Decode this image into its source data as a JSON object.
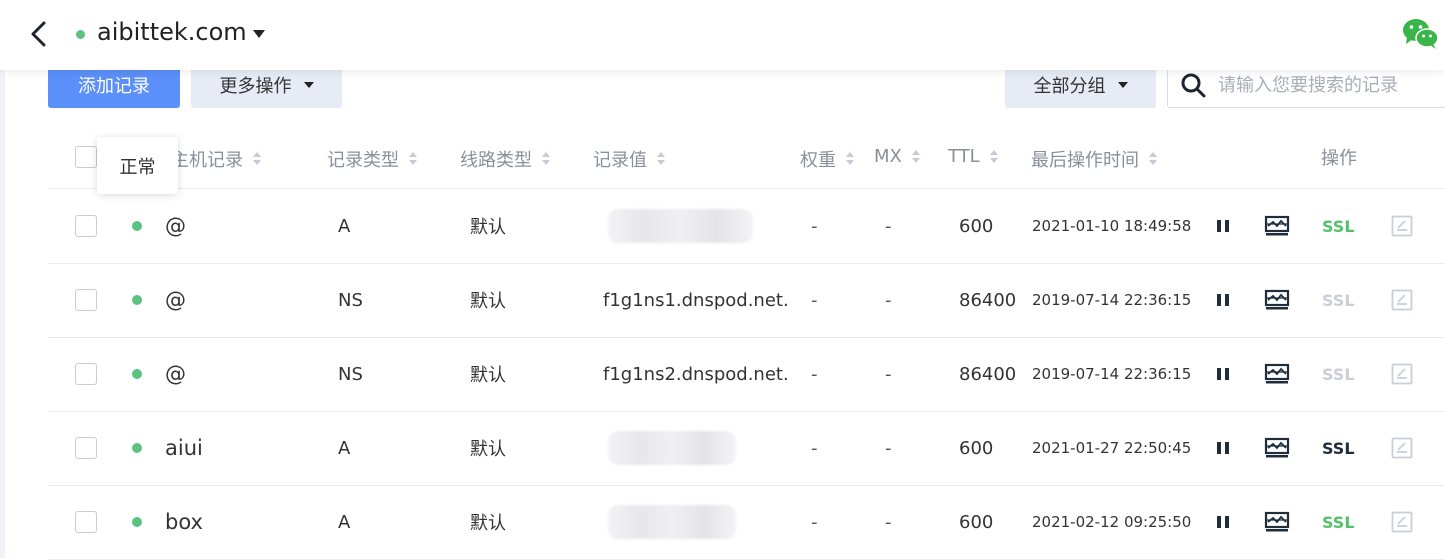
{
  "header": {
    "domain": "aibittek.com",
    "status_color": "#5cc281"
  },
  "toolbar": {
    "add_label": "添加记录",
    "more_label": "更多操作",
    "group_label": "全部分组",
    "search_placeholder": "请输入您要搜索的记录"
  },
  "tooltip": {
    "text": "正常"
  },
  "table": {
    "headers": {
      "host": "主机记录",
      "type": "记录类型",
      "line": "线路类型",
      "value": "记录值",
      "weight": "权重",
      "mx": "MX",
      "ttl": "TTL",
      "time": "最后操作时间",
      "ops": "操作"
    },
    "rows": [
      {
        "host": "@",
        "type": "A",
        "line": "默认",
        "value": "",
        "weight": "-",
        "mx": "-",
        "ttl": "600",
        "time": "2021-01-10 18:49:58",
        "ssl": "SSL",
        "ssl_state": "green"
      },
      {
        "host": "@",
        "type": "NS",
        "line": "默认",
        "value": "f1g1ns1.dnspod.net.",
        "weight": "-",
        "mx": "-",
        "ttl": "86400",
        "time": "2019-07-14 22:36:15",
        "ssl": "SSL",
        "ssl_state": "disabled"
      },
      {
        "host": "@",
        "type": "NS",
        "line": "默认",
        "value": "f1g1ns2.dnspod.net.",
        "weight": "-",
        "mx": "-",
        "ttl": "86400",
        "time": "2019-07-14 22:36:15",
        "ssl": "SSL",
        "ssl_state": "disabled"
      },
      {
        "host": "aiui",
        "type": "A",
        "line": "默认",
        "value": "",
        "weight": "-",
        "mx": "-",
        "ttl": "600",
        "time": "2021-01-27 22:50:45",
        "ssl": "SSL",
        "ssl_state": "dark"
      },
      {
        "host": "box",
        "type": "A",
        "line": "默认",
        "value": "",
        "weight": "-",
        "mx": "-",
        "ttl": "600",
        "time": "2021-02-12 09:25:50",
        "ssl": "SSL",
        "ssl_state": "green"
      }
    ]
  },
  "colors": {
    "ssl_green": "#52c26b",
    "ssl_dark": "#1f2d3d",
    "ssl_disabled": "#c9ced8",
    "primary": "#5b8ff9"
  },
  "icons": [
    "back-icon",
    "wechat-icon",
    "search-icon",
    "pause-icon",
    "monitor-icon",
    "edit-icon"
  ]
}
